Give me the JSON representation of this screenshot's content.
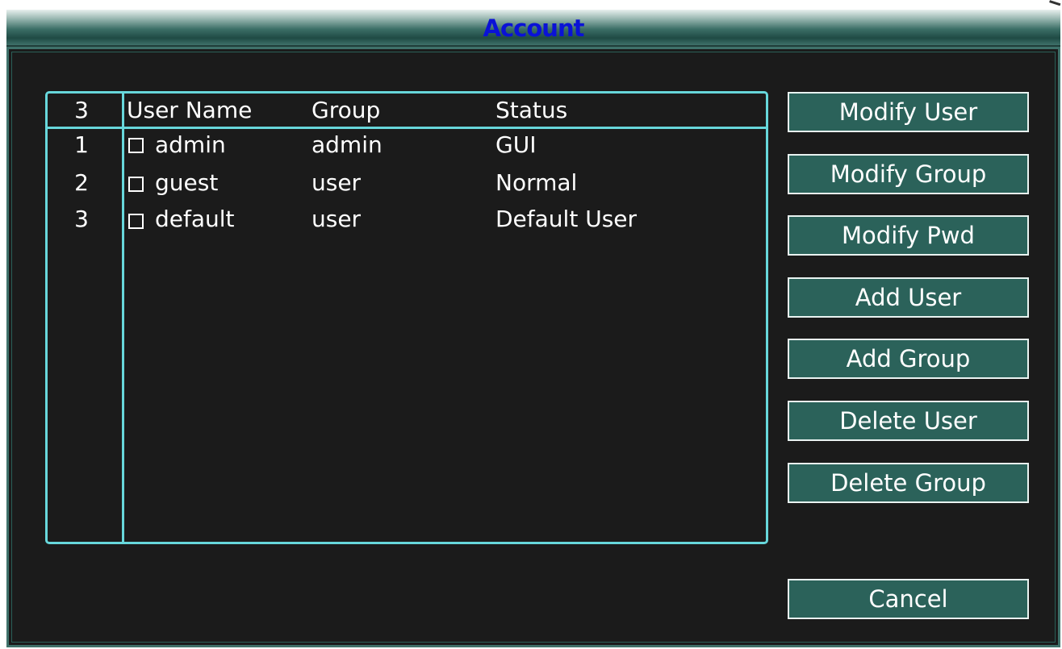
{
  "window": {
    "title": "Account"
  },
  "user_list": {
    "header": {
      "count": "3",
      "user_name": "User Name",
      "group": "Group",
      "status": "Status"
    },
    "rows": [
      {
        "index": "1",
        "checked": false,
        "user_name": "admin",
        "group": "admin",
        "status": "GUI"
      },
      {
        "index": "2",
        "checked": false,
        "user_name": "guest",
        "group": "user",
        "status": "Normal"
      },
      {
        "index": "3",
        "checked": false,
        "user_name": "default",
        "group": "user",
        "status": "Default User"
      }
    ]
  },
  "buttons": {
    "modify_user": "Modify User",
    "modify_group": "Modify Group",
    "modify_pwd": "Modify Pwd",
    "add_user": "Add User",
    "add_group": "Add Group",
    "delete_user": "Delete User",
    "delete_group": "Delete Group",
    "cancel": "Cancel"
  },
  "colors": {
    "title_text": "#0a12d6",
    "panel_background": "#1b1b1b",
    "list_border": "#67d7db",
    "button_background": "#2b625a",
    "frame": "#3f716a"
  }
}
